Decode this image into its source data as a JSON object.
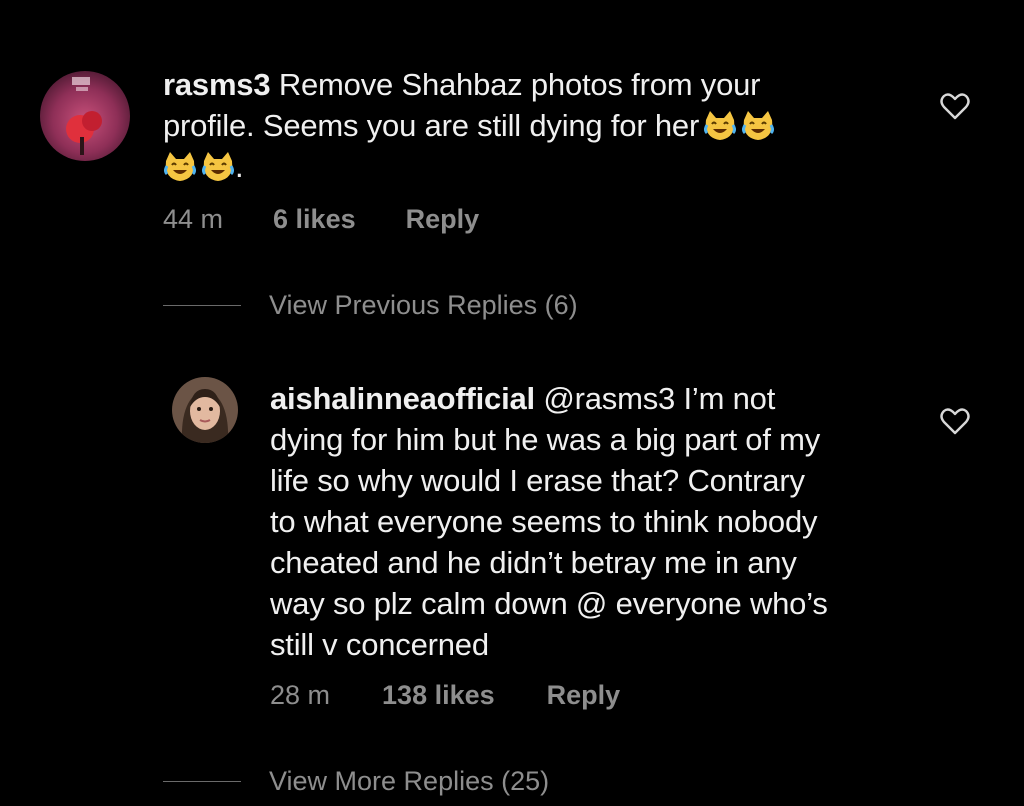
{
  "comments": [
    {
      "username": "rasms3",
      "text_line1": "Remove Shahbaz photos from your",
      "text_line2": "profile. Seems you are still dying for her",
      "text_line3_suffix": ".",
      "emoji_name": "grinning-cat-with-tears-of-joy",
      "time": "44 m",
      "likes": "6 likes",
      "reply_label": "Reply"
    },
    {
      "username": "aishalinneaofficial",
      "mention": "@rasms3",
      "text_line1": "I’m not",
      "lines": [
        "dying for him but he was a big part of my",
        "life so why would I erase that? Contrary",
        "to what everyone seems to think nobody",
        "cheated and he didn’t betray me in any",
        "way so plz calm down @ everyone who’s",
        "still v concerned"
      ],
      "time": "28 m",
      "likes": "138 likes",
      "reply_label": "Reply"
    }
  ],
  "view_previous_replies": "View Previous Replies (6)",
  "view_more_replies": "View More Replies (25)",
  "colors": {
    "background": "#000000",
    "text": "#f0f0f0",
    "secondary_text": "#8e8e8e",
    "emoji_yellow": "#f5c542"
  },
  "icons": {
    "like": "heart-outline-icon"
  }
}
